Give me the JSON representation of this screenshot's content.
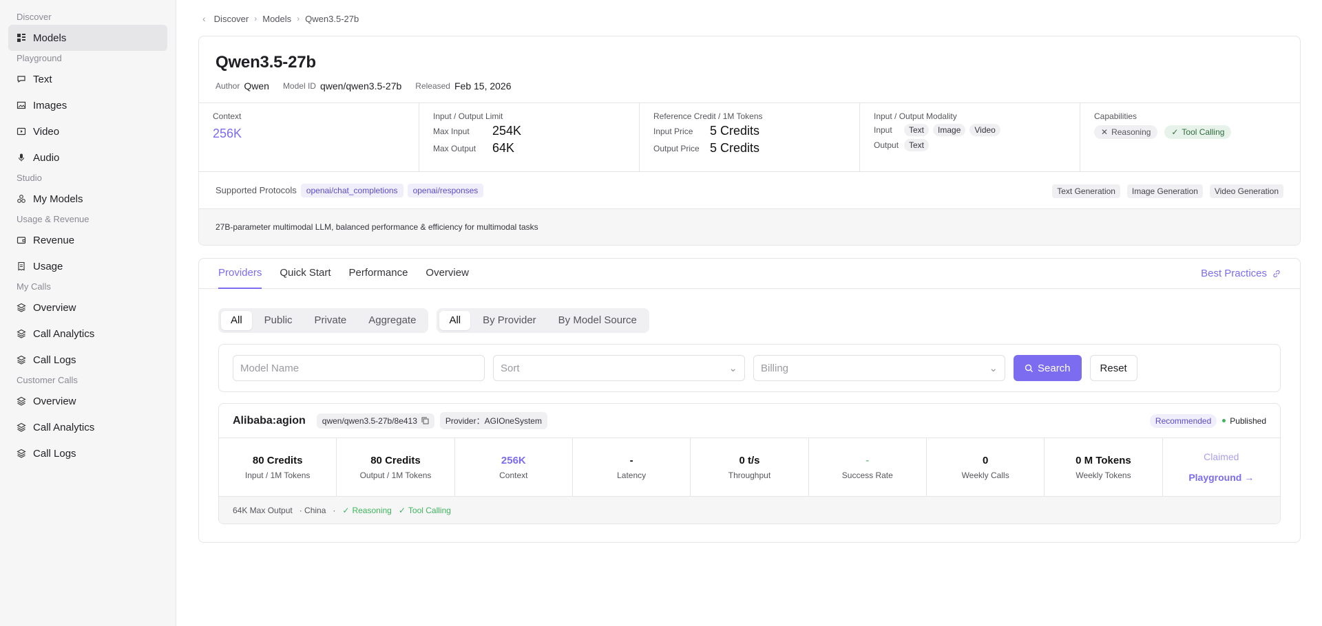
{
  "sidebar": {
    "discover_label": "Discover",
    "models": "Models",
    "playground_label": "Playground",
    "text": "Text",
    "images": "Images",
    "video": "Video",
    "audio": "Audio",
    "studio_label": "Studio",
    "my_models": "My Models",
    "usage_label": "Usage & Revenue",
    "revenue": "Revenue",
    "usage": "Usage",
    "mycalls_label": "My Calls",
    "mc_overview": "Overview",
    "mc_analytics": "Call Analytics",
    "mc_logs": "Call Logs",
    "customer_label": "Customer Calls",
    "cc_overview": "Overview",
    "cc_analytics": "Call Analytics",
    "cc_logs": "Call Logs"
  },
  "breadcrumb": {
    "a": "Discover",
    "b": "Models",
    "c": "Qwen3.5-27b"
  },
  "model": {
    "title": "Qwen3.5-27b",
    "author_k": "Author",
    "author_v": "Qwen",
    "id_k": "Model ID",
    "id_v": "qwen/qwen3.5-27b",
    "released_k": "Released",
    "released_v": "Feb 15, 2026",
    "context_lbl": "Context",
    "context_v": "256K",
    "limit_lbl": "Input / Output Limit",
    "max_in_k": "Max Input",
    "max_in_v": "254K",
    "max_out_k": "Max Output",
    "max_out_v": "64K",
    "credit_lbl": "Reference Credit / 1M Tokens",
    "in_price_k": "Input Price",
    "in_price_v": "5 Credits",
    "out_price_k": "Output Price",
    "out_price_v": "5 Credits",
    "modality_lbl": "Input / Output Modality",
    "mod_in_k": "Input",
    "mod_in": [
      "Text",
      "Image",
      "Video"
    ],
    "mod_out_k": "Output",
    "mod_out": [
      "Text"
    ],
    "cap_lbl": "Capabilities",
    "cap_no": "Reasoning",
    "cap_yes": "Tool Calling",
    "proto_lbl": "Supported Protocols",
    "proto1": "openai/chat_completions",
    "proto2": "openai/responses",
    "task1": "Text Generation",
    "task2": "Image Generation",
    "task3": "Video Generation",
    "description": "27B-parameter multimodal LLM, balanced performance & efficiency for multimodal tasks"
  },
  "tabs": {
    "providers": "Providers",
    "quick": "Quick Start",
    "perf": "Performance",
    "overview": "Overview",
    "best": "Best Practices"
  },
  "filters": {
    "seg1": [
      "All",
      "Public",
      "Private",
      "Aggregate"
    ],
    "seg2": [
      "All",
      "By Provider",
      "By Model Source"
    ],
    "model_ph": "Model Name",
    "sort_ph": "Sort",
    "billing_ph": "Billing",
    "search": "Search",
    "reset": "Reset"
  },
  "provider": {
    "name": "Alibaba:agion",
    "route": "qwen/qwen3.5-27b/8e413",
    "provider_chip": "Provider：AGIOneSystem",
    "recommended": "Recommended",
    "status": "Published",
    "m_in_v": "80 Credits",
    "m_in_l": "Input / 1M Tokens",
    "m_out_v": "80 Credits",
    "m_out_l": "Output / 1M Tokens",
    "m_ctx_v": "256K",
    "m_ctx_l": "Context",
    "m_lat_v": "-",
    "m_lat_l": "Latency",
    "m_thr_v": "0 t/s",
    "m_thr_l": "Throughput",
    "m_sr_v": "-",
    "m_sr_l": "Success Rate",
    "m_wc_v": "0",
    "m_wc_l": "Weekly Calls",
    "m_wt_v": "0 M Tokens",
    "m_wt_l": "Weekly Tokens",
    "claimed": "Claimed",
    "playground": "Playground →",
    "foot_max": "64K Max Output",
    "foot_region": "· China",
    "foot_dot": "·",
    "foot_reason": "Reasoning",
    "foot_tool": "Tool Calling"
  }
}
